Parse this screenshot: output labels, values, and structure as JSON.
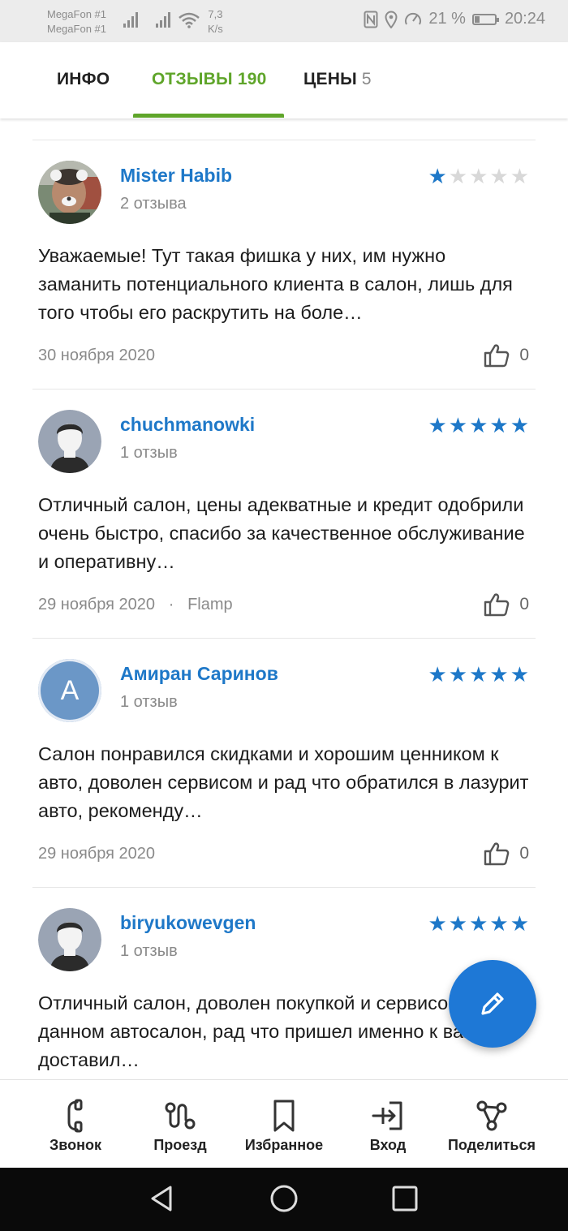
{
  "status_bar": {
    "carrier1": "MegaFon #1",
    "carrier2": "MegaFon #1",
    "speed_value": "7,3",
    "speed_unit": "K/s",
    "battery": "21 %",
    "time": "20:24",
    "icons": [
      "nfc-icon",
      "location-icon",
      "speed-meter-icon",
      "battery-icon",
      "signal-icon",
      "wifi-icon"
    ]
  },
  "tabs": [
    {
      "label": "ИНФО",
      "count": ""
    },
    {
      "label": "ОТЗЫВЫ",
      "count": "190"
    },
    {
      "label": "ЦЕНЫ",
      "count": "5"
    }
  ],
  "reviews": [
    {
      "author": "Mister Habib",
      "reviews_count": "2 отзыва",
      "rating": 1,
      "text": "Уважаемые! Тут такая фишка у них, им нужно заманить потенциального клиента в салон, лишь для того чтобы его раскрутить на боле…",
      "date": "30 ноября 2020",
      "source": "",
      "likes": "0",
      "avatar": "photo"
    },
    {
      "author": "chuchmanowki",
      "reviews_count": "1 отзыв",
      "rating": 5,
      "text": "Отличный салон, цены адекватные и кредит одобрили очень быстро, спасибо за качественное обслуживание и оперативну…",
      "date": "29 ноября 2020",
      "source": "Flamp",
      "likes": "0",
      "avatar": "default"
    },
    {
      "author": "Амиран Саринов",
      "reviews_count": "1 отзыв",
      "rating": 5,
      "text": "Салон понравился скидками и хорошим ценником к авто, доволен сервисом и рад что обратился в лазурит авто, рекоменду…",
      "date": "29 ноября 2020",
      "source": "",
      "likes": "0",
      "avatar": "letter",
      "avatar_letter": "А"
    },
    {
      "author": "biryukowevgen",
      "reviews_count": "1 отзыв",
      "rating": 5,
      "text": "Отличный салон, доволен покупкой и сервисом в данном автосалон, рад что пришел именно к вам, доставил…",
      "date": "",
      "source": "",
      "likes": "",
      "avatar": "default"
    }
  ],
  "bottom_nav": [
    {
      "label": "Звонок",
      "icon": "phone-icon"
    },
    {
      "label": "Проезд",
      "icon": "route-icon"
    },
    {
      "label": "Избранное",
      "icon": "bookmark-icon"
    },
    {
      "label": "Вход",
      "icon": "entrance-icon"
    },
    {
      "label": "Поделиться",
      "icon": "share-icon"
    }
  ],
  "colors": {
    "accent_green": "#5fa52a",
    "link_blue": "#1e78c8",
    "fab_blue": "#1e78d6",
    "star_off": "#d8d8d8"
  }
}
